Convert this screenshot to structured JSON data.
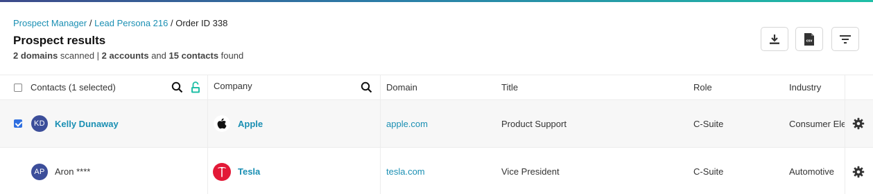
{
  "breadcrumb": {
    "items": [
      "Prospect Manager",
      "Lead Persona 216"
    ],
    "current": "Order ID 338",
    "separator": "/"
  },
  "page": {
    "title": "Prospect results",
    "summary": {
      "domains_count": "2 domains",
      "scanned_text": " scanned | ",
      "accounts_count": "2 accounts",
      "and_text": " and ",
      "contacts_count": "15 contacts",
      "found_text": " found"
    }
  },
  "toolbar": {
    "buttons": [
      {
        "icon": "download-icon"
      },
      {
        "icon": "csv-file-icon",
        "label": "csv"
      },
      {
        "icon": "filter-icon"
      }
    ]
  },
  "table": {
    "columns": {
      "contacts": "Contacts (1 selected)",
      "company": "Company",
      "domain": "Domain",
      "title": "Title",
      "role": "Role",
      "industry": "Industry"
    },
    "rows": [
      {
        "selected": true,
        "initials": "KD",
        "name": "Kelly Dunaway",
        "company": "Apple",
        "company_logo": "apple-logo-icon",
        "domain": "apple.com",
        "title": "Product Support",
        "role": "C-Suite",
        "industry": "Consumer Ele"
      },
      {
        "selected": false,
        "initials": "AP",
        "name": "Aron ****",
        "company": "Tesla",
        "company_logo": "tesla-logo-icon",
        "domain": "tesla.com",
        "title": "Vice President",
        "role": "C-Suite",
        "industry": "Automotive"
      }
    ]
  },
  "colors": {
    "link": "#1a8fb3",
    "avatar": "#3c4e9a",
    "unlock_icon": "#1fbfa6",
    "tesla_red": "#e31937",
    "checkbox_checked": "#2f6fe0"
  }
}
